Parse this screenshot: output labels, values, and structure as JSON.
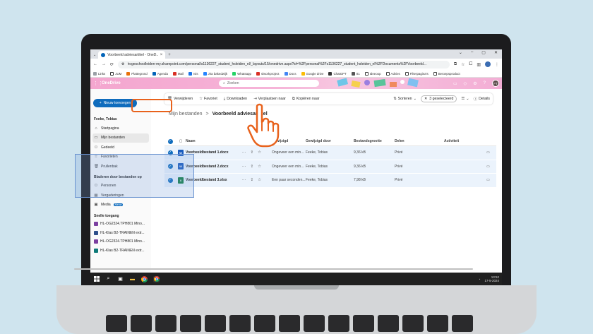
{
  "browser": {
    "tab_title": "Voorbeeld adviesartikel - OneD...",
    "tab_close": "×",
    "new_tab": "+",
    "window_controls": [
      "⌄",
      "–",
      "▢",
      "✕"
    ],
    "url": "hogeschoolleiden-my.sharepoint.com/personal/s1136227_student_hsleiden_nl/_layouts/15/onedrive.aspx?id=%2Fpersonal%2Fs1136227_student_hsleiden_nl%2FDocuments%2FVoorbeeld...",
    "nav": [
      "←",
      "→",
      "⟳"
    ],
    "bookmarks": [
      "Links",
      "JUM",
      "Plattegrond",
      "Agenda",
      "Mail",
      "Isis",
      "Jira bakedwijk",
      "Whatsapp",
      "slworkproject",
      "Docs",
      "Google drive",
      "ChatGPT",
      "01",
      "Ideeoop",
      "Advies",
      "Filterpagina's",
      "Beroepsproduct"
    ]
  },
  "onedrive": {
    "app_title": "OneDrive",
    "search_placeholder": "Zoeken",
    "avatar": "FT"
  },
  "sidebar": {
    "new_button": "Nieuw toevoegen",
    "user": "Feeke, Tobias",
    "nav": [
      {
        "icon": "⌂",
        "label": "Startpagina"
      },
      {
        "icon": "▭",
        "label": "Mijn bestanden"
      },
      {
        "icon": "⚇",
        "label": "Gedeeld"
      },
      {
        "icon": "☆",
        "label": "Favorieten"
      },
      {
        "icon": "🗑",
        "label": "Prullenbak"
      }
    ],
    "browse_heading": "Bladeren door bestanden op",
    "browse": [
      {
        "icon": "⚇",
        "label": "Personen"
      },
      {
        "icon": "▦",
        "label": "Vergaderingen"
      },
      {
        "icon": "▣",
        "label": "Media",
        "badge": "Nieuw"
      }
    ],
    "quick_heading": "Snelle toegang",
    "quick": [
      {
        "label": "HL-OG2324.TPH801 Mino...",
        "color": "#7b3fa0"
      },
      {
        "label": "HL-Klas B2-TRAINEN extr...",
        "color": "#2e4f8a"
      },
      {
        "label": "HL-OG2324.TPH801 Mino...",
        "color": "#7b3fa0"
      },
      {
        "label": "HL-Klas B2-TRAINEN extr...",
        "color": "#0e7a78"
      }
    ]
  },
  "commandbar": {
    "delete": "Verwijderen",
    "favorite": "Favoriet",
    "download": "Downloaden",
    "move": "Verplaatsen naar",
    "copy": "Kopiëren naar",
    "sort": "Sorteren",
    "selected": "3 geselecteerd",
    "details": "Details"
  },
  "breadcrumb": {
    "parent": "Mijn bestanden",
    "separator": ">",
    "current": "Voorbeeld adviesartikel"
  },
  "table": {
    "headers": {
      "name": "Naam",
      "modified": "Gewijzigd",
      "modified_by": "Gewijzigd door",
      "size": "Bestandsgrootte",
      "sharing": "Delen",
      "activity": "Activiteit"
    },
    "rows": [
      {
        "name": "Voorbeeldbestand 1.docx",
        "type": "W",
        "color": "#185abd",
        "modified": "Ongeveer een min...",
        "by": "Feeke, Tobias",
        "size": "9,36 kB",
        "sharing": "Privé"
      },
      {
        "name": "Voorbeeldbestand 2.docx",
        "type": "W",
        "color": "#185abd",
        "modified": "Ongeveer een min...",
        "by": "Feeke, Tobias",
        "size": "9,36 kB",
        "sharing": "Privé"
      },
      {
        "name": "Voorbeeldbestand 3.xlsx",
        "type": "X",
        "color": "#107c41",
        "modified": "Een paar seconden...",
        "by": "Feeke, Tobias",
        "size": "7,98 kB",
        "sharing": "Privé"
      }
    ]
  },
  "taskbar": {
    "time": "13:52",
    "date": "17-5-2024"
  }
}
